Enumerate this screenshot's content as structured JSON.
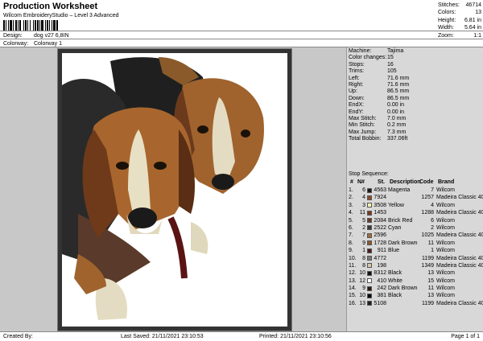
{
  "header": {
    "title": "Production Worksheet",
    "subtitle": "Wilcom EmbroideryStudio – Level 3 Advanced",
    "design_label": "Design:",
    "design_value": "dog v27 6,8IN",
    "colorway_label": "Colorway:",
    "colorway_value": "Colorway 1"
  },
  "stats": [
    {
      "label": "Stitches:",
      "value": "46714"
    },
    {
      "label": "Colors:",
      "value": "13"
    },
    {
      "label": "Height:",
      "value": "6.81 in"
    },
    {
      "label": "Width:",
      "value": "5.64 in"
    },
    {
      "label": "Zoom:",
      "value": "1:1"
    }
  ],
  "machine_info": [
    {
      "label": "Machine:",
      "value": "Tajima"
    },
    {
      "label": "Color changes:",
      "value": "15"
    },
    {
      "label": "Stops:",
      "value": "16"
    },
    {
      "label": "Trims:",
      "value": "105"
    },
    {
      "label": "Left:",
      "value": "71.6 mm"
    },
    {
      "label": "Right:",
      "value": "71.6 mm"
    },
    {
      "label": "Up:",
      "value": "86.5 mm"
    },
    {
      "label": "Down:",
      "value": "86.5 mm"
    },
    {
      "label": "EndX:",
      "value": "0.00 in"
    },
    {
      "label": "EndY:",
      "value": "0.00 in"
    },
    {
      "label": "Max Stitch:",
      "value": "7.0 mm"
    },
    {
      "label": "Min Stitch:",
      "value": "0.2 mm"
    },
    {
      "label": "Max Jump:",
      "value": "7.3 mm"
    },
    {
      "label": "Total Bobbin:",
      "value": "337.06ft"
    }
  ],
  "stop_sequence": {
    "title": "Stop Sequence:",
    "headers": {
      "no": "#",
      "n": "N#",
      "st": "St.",
      "desc": "Description",
      "code": "Code",
      "brand": "Brand"
    },
    "rows": [
      {
        "no": "1.",
        "n": "6",
        "color": "#1a1a1a",
        "st": "4563",
        "desc": "Magenta",
        "code": "7",
        "brand": "Wilcom"
      },
      {
        "no": "2.",
        "n": "4",
        "color": "#8b4a2b",
        "st": "7924",
        "desc": "",
        "code": "1257",
        "brand": "Madeira Classic 40"
      },
      {
        "no": "3.",
        "n": "3",
        "color": "#f4f4b0",
        "st": "3508",
        "desc": "Yellow",
        "code": "4",
        "brand": "Wilcom"
      },
      {
        "no": "4.",
        "n": "11",
        "color": "#7a3a1c",
        "st": "1453",
        "desc": "",
        "code": "1288",
        "brand": "Madeira Classic 40"
      },
      {
        "no": "5.",
        "n": "5",
        "color": "#6b3a2a",
        "st": "2084",
        "desc": "Brick Red",
        "code": "6",
        "brand": "Wilcom"
      },
      {
        "no": "6.",
        "n": "2",
        "color": "#3a3a3a",
        "st": "2522",
        "desc": "Cyan",
        "code": "2",
        "brand": "Wilcom"
      },
      {
        "no": "7.",
        "n": "7",
        "color": "#a36a3a",
        "st": "2596",
        "desc": "",
        "code": "1025",
        "brand": "Madeira Classic 40"
      },
      {
        "no": "8.",
        "n": "9",
        "color": "#8a5a2a",
        "st": "1728",
        "desc": "Dark Brown",
        "code": "11",
        "brand": "Wilcom"
      },
      {
        "no": "9.",
        "n": "1",
        "color": "#4a1a1a",
        "st": "911",
        "desc": "Blue",
        "code": "1",
        "brand": "Wilcom"
      },
      {
        "no": "10.",
        "n": "8",
        "color": "#7a7a7a",
        "st": "4772",
        "desc": "",
        "code": "1199",
        "brand": "Madeira Classic 40"
      },
      {
        "no": "11.",
        "n": "8",
        "color": "#d8c8a8",
        "st": "198",
        "desc": "",
        "code": "1349",
        "brand": "Madeira Classic 40"
      },
      {
        "no": "12.",
        "n": "10",
        "color": "#111111",
        "st": "8312",
        "desc": "Black",
        "code": "13",
        "brand": "Wilcom"
      },
      {
        "no": "13.",
        "n": "12",
        "color": "#ffffff",
        "st": "410",
        "desc": "White",
        "code": "15",
        "brand": "Wilcom"
      },
      {
        "no": "14.",
        "n": "9",
        "color": "#2a1a10",
        "st": "242",
        "desc": "Dark Brown",
        "code": "11",
        "brand": "Wilcom"
      },
      {
        "no": "15.",
        "n": "10",
        "color": "#0a0a0a",
        "st": "381",
        "desc": "Black",
        "code": "13",
        "brand": "Wilcom"
      },
      {
        "no": "16.",
        "n": "13",
        "color": "#1e1e1e",
        "st": "5108",
        "desc": "",
        "code": "1199",
        "brand": "Madeira Classic 40"
      }
    ]
  },
  "footer": {
    "created_by": "Created By:",
    "last_saved": "Last Saved: 21/11/2021 23:10:53",
    "printed": "Printed: 21/11/2021 23:10:56",
    "page": "Page 1 of 1"
  },
  "colors": {
    "canvas_bg": "#c8c8c8",
    "panel_bg": "#d8d8d8",
    "frame_border": "#333333"
  }
}
